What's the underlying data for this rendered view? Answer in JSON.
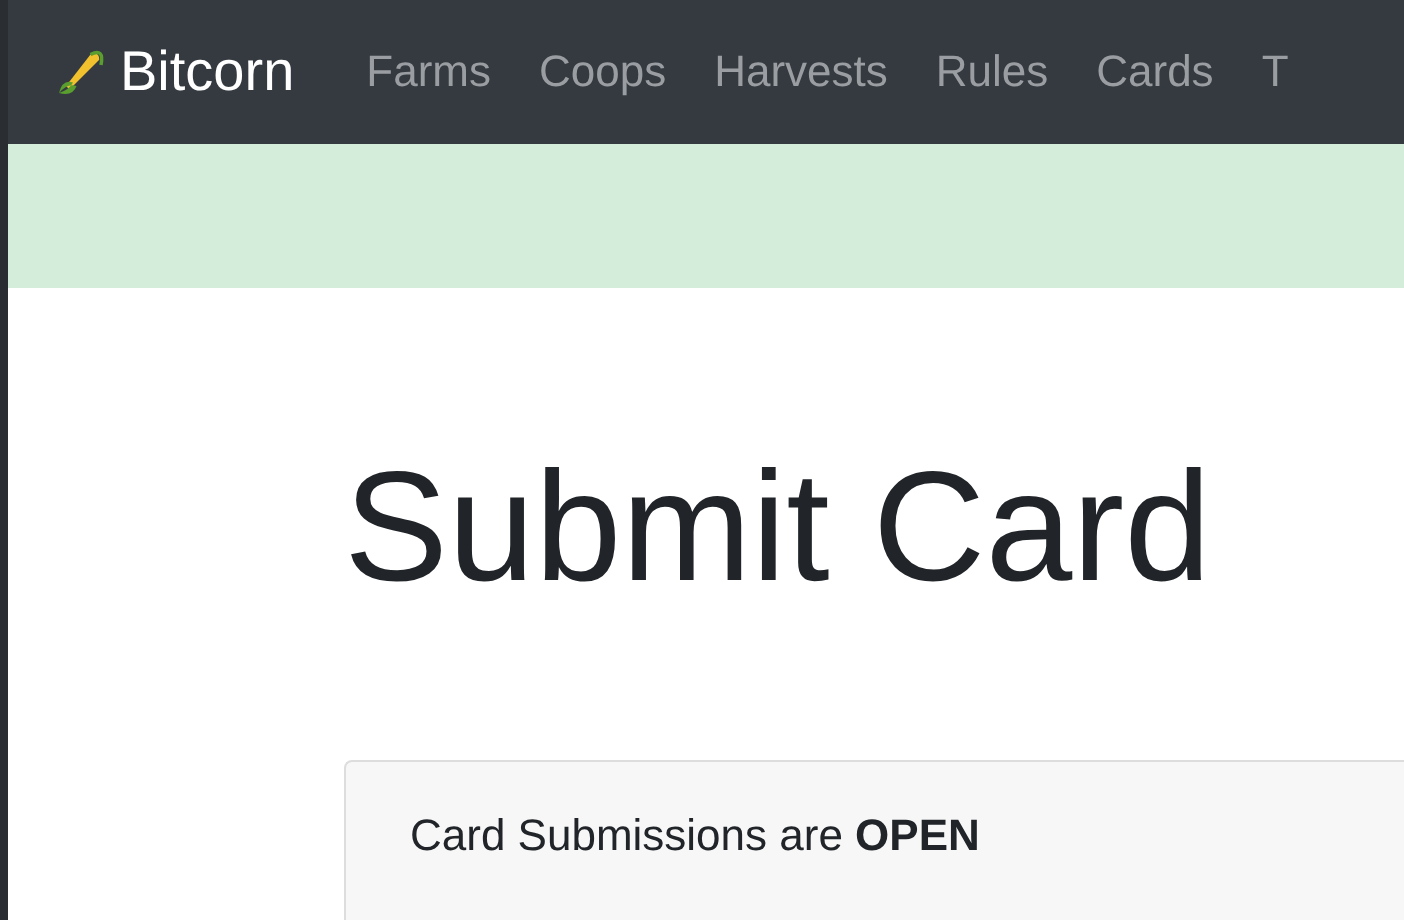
{
  "navbar": {
    "brand": "Bitcorn",
    "items": [
      "Farms",
      "Coops",
      "Harvests",
      "Rules",
      "Cards",
      "T"
    ]
  },
  "page": {
    "title": "Submit Card"
  },
  "card": {
    "text": "Card Submissions are **OPEN**"
  }
}
